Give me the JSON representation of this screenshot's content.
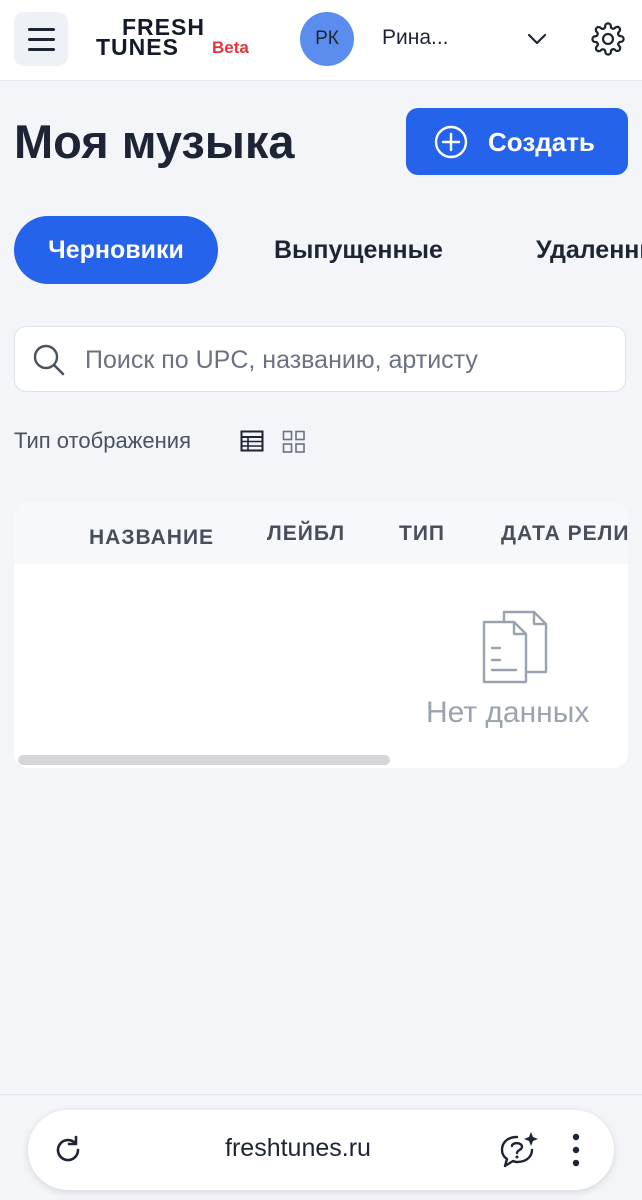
{
  "header": {
    "logo_line1": "FRESH",
    "logo_line2": "TUNES",
    "logo_beta": "Beta",
    "avatar_initials": "РК",
    "user_name": "Рина..."
  },
  "main": {
    "title": "Моя музыка",
    "create_button": "Создать",
    "tabs": [
      {
        "label": "Черновики",
        "active": true
      },
      {
        "label": "Выпущенные",
        "active": false
      },
      {
        "label": "Удаленные",
        "active": false
      }
    ],
    "search": {
      "placeholder": "Поиск по UPC, названию, артисту",
      "value": ""
    },
    "view_type_label": "Тип отображения",
    "table": {
      "columns": [
        "НАЗВАНИЕ",
        "ЛЕЙБЛ",
        "ТИП",
        "ДАТА РЕЛИЗА"
      ],
      "rows": [],
      "empty_text": "Нет данных"
    }
  },
  "browser": {
    "url": "freshtunes.ru"
  },
  "colors": {
    "accent": "#2563eb",
    "logo_beta": "#e0383e",
    "avatar": "#5b8def",
    "page_background": "#f3f5f9"
  },
  "icons": [
    "menu-icon",
    "chevron-down-icon",
    "gear-icon",
    "plus-circle-icon",
    "search-icon",
    "table-view-icon",
    "grid-view-icon",
    "empty-document-icon",
    "reload-icon",
    "ai-assistant-icon",
    "more-vertical-icon"
  ]
}
